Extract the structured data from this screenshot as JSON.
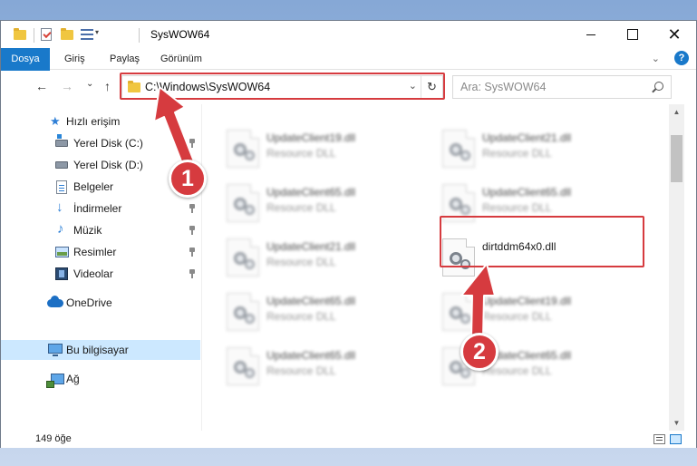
{
  "window": {
    "title": "SysWOW64",
    "minimize": "",
    "maximize": "",
    "close": "✕"
  },
  "ribbon": {
    "tabs": [
      "Dosya",
      "Giriş",
      "Paylaş",
      "Görünüm"
    ],
    "help": "?"
  },
  "nav": {
    "back": "←",
    "forward": "→",
    "recent": "⌄",
    "up": "↑",
    "address": "C:\\Windows\\SysWOW64",
    "address_dropdown": "⌄",
    "refresh": "↻",
    "search_placeholder": "Ara: SysWOW64"
  },
  "sidebar": {
    "items": [
      {
        "label": "Hızlı erişim",
        "icon": "star-icon"
      },
      {
        "label": "Yerel Disk (C:)",
        "icon": "drive-c-icon"
      },
      {
        "label": "Yerel Disk (D:)",
        "icon": "drive-d-icon"
      },
      {
        "label": "Belgeler",
        "icon": "documents-icon"
      },
      {
        "label": "İndirmeler",
        "icon": "downloads-icon"
      },
      {
        "label": "Müzik",
        "icon": "music-icon"
      },
      {
        "label": "Resimler",
        "icon": "pictures-icon"
      },
      {
        "label": "Videolar",
        "icon": "videos-icon"
      },
      {
        "label": "OneDrive",
        "icon": "onedrive-icon"
      },
      {
        "label": "Bu bilgisayar",
        "icon": "this-pc-icon"
      },
      {
        "label": "Ağ",
        "icon": "network-icon"
      }
    ]
  },
  "files": [
    {
      "name": "UpdateClient19.dll",
      "desc": "Resource DLL"
    },
    {
      "name": "UpdateClient21.dll",
      "desc": "Resource DLL"
    },
    {
      "name": "UpdateClient65.dll",
      "desc": "Resource DLL"
    },
    {
      "name": "UpdateClient65.dll",
      "desc": "Resource DLL"
    },
    {
      "name": "UpdateClient21.dll",
      "desc": "Resource DLL"
    },
    {
      "name": "dirtddm64x0.dll",
      "desc": ""
    },
    {
      "name": "UpdateClient65.dll",
      "desc": "Resource DLL"
    },
    {
      "name": "UpdateClient19.dll",
      "desc": "Resource DLL"
    },
    {
      "name": "UpdateClient65.dll",
      "desc": "Resource DLL"
    },
    {
      "name": "UpdateClient65.dll",
      "desc": "Resource DLL"
    }
  ],
  "status": {
    "count": "149 öğe"
  },
  "scrollbar": {
    "up": "▲",
    "down": "▼"
  },
  "annotations": {
    "badge1": "1",
    "badge2": "2",
    "color": "#d63b3f"
  }
}
